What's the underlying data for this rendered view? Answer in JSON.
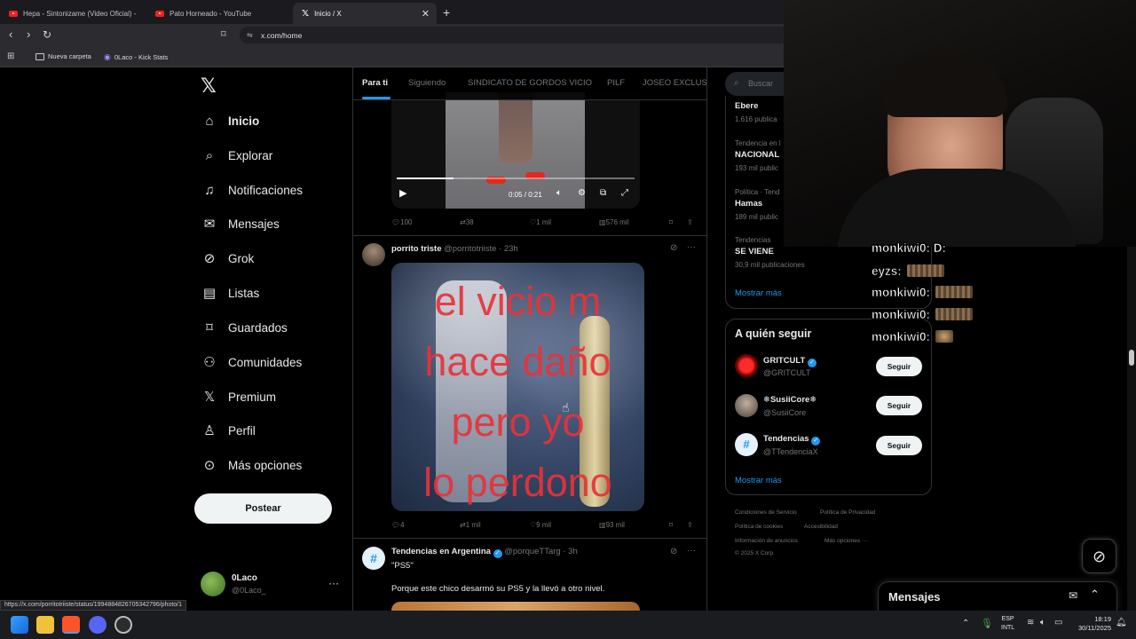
{
  "browser": {
    "tabs": [
      {
        "label": "Hepa - Sintonizame (Video Oficial) - "
      },
      {
        "label": "Pato Horneado - YouTube"
      },
      {
        "label": "Inicio / X"
      }
    ],
    "url": "x.com/home",
    "bookmarks": [
      "Nueva carpeta",
      "0Laco - Kick Stats"
    ],
    "status_url": "https://x.com/porritotriiste/status/1994884826705342796/photo/1"
  },
  "nav": {
    "items": [
      {
        "label": "Inicio",
        "icon": "home-icon"
      },
      {
        "label": "Explorar",
        "icon": "search-icon"
      },
      {
        "label": "Notificaciones",
        "icon": "bell-icon"
      },
      {
        "label": "Mensajes",
        "icon": "envelope-icon"
      },
      {
        "label": "Grok",
        "icon": "grok-icon"
      },
      {
        "label": "Listas",
        "icon": "list-icon"
      },
      {
        "label": "Guardados",
        "icon": "bookmark-icon"
      },
      {
        "label": "Comunidades",
        "icon": "people-icon"
      },
      {
        "label": "Premium",
        "icon": "x-icon"
      },
      {
        "label": "Perfil",
        "icon": "person-icon"
      },
      {
        "label": "Más opciones",
        "icon": "more-circle-icon"
      }
    ],
    "post_label": "Postear",
    "profile_name": "0Laco",
    "profile_handle": "@0Laco_"
  },
  "feed": {
    "tabs": [
      "Para ti",
      "Siguiendo",
      "SINDICATO DE GORDOS VICIO",
      "PILF",
      "JOSEO EXCLUSIV"
    ],
    "video": {
      "time": "0:05 / 0:21",
      "progress": 0.24
    },
    "post1_actions": {
      "replies": "100",
      "reposts": "38",
      "likes": "1 mil",
      "views": "576 mil"
    },
    "post2": {
      "name": "porrito triste",
      "handle": "@porritotriiste",
      "time": "· 23h",
      "image_text": [
        "el vicio m",
        "hace daño",
        "pero yo",
        "lo perdono"
      ],
      "actions": {
        "replies": "4",
        "reposts": "1 mil",
        "likes": "9 mil",
        "views": "93 mil"
      }
    },
    "post3": {
      "name": "Tendencias en Argentina",
      "handle": "@porqueTTarg",
      "time": "· 3h",
      "line1": "\"PS5\"",
      "line2": "Porque este chico desarmó su PS5 y la llevó a otro nivel."
    }
  },
  "right": {
    "search_placeholder": "Buscar",
    "trends": [
      {
        "category": "",
        "name": "Ebere",
        "count": "1.616 publica"
      },
      {
        "category": "Tendencia en l",
        "name": "NACIONAL",
        "count": "193 mil public"
      },
      {
        "category": "Política · Tend",
        "name": "Hamas",
        "count": "189 mil public"
      },
      {
        "category": "Tendencias",
        "name": "SE VIENE",
        "count": "30,9 mil publicaciones"
      }
    ],
    "show_more": "Mostrar más",
    "who_to_follow_title": "A quién seguir",
    "who_to_follow": [
      {
        "name": "GRITCULT",
        "handle": "@GRITCULT",
        "verified": true,
        "button": "Seguir"
      },
      {
        "name": "❄SusiiCore❄",
        "handle": "@SusiiCore",
        "verified": false,
        "button": "Seguir"
      },
      {
        "name": "Tendencias",
        "handle": "@TTendenciaX",
        "verified": true,
        "button": "Seguir"
      }
    ],
    "footer": [
      "Condiciones de Servicio",
      "Política de Privacidad",
      "Política de cookies",
      "Accesibilidad",
      "Información de anuncios",
      "Más opciones ···",
      "© 2025 X Corp."
    ],
    "messages_label": "Mensajes"
  },
  "chat": [
    {
      "user": "monkiwi0:",
      "text": "D:"
    },
    {
      "user": "eyzs:",
      "text": ""
    },
    {
      "user": "monkiwi0:",
      "text": ""
    },
    {
      "user": "monkiwi0:",
      "text": ""
    },
    {
      "user": "monkiwi0:",
      "text": ""
    }
  ],
  "taskbar": {
    "lang": "ESP",
    "layout": "INTL",
    "time": "18:19",
    "date": "30/11/2025"
  }
}
